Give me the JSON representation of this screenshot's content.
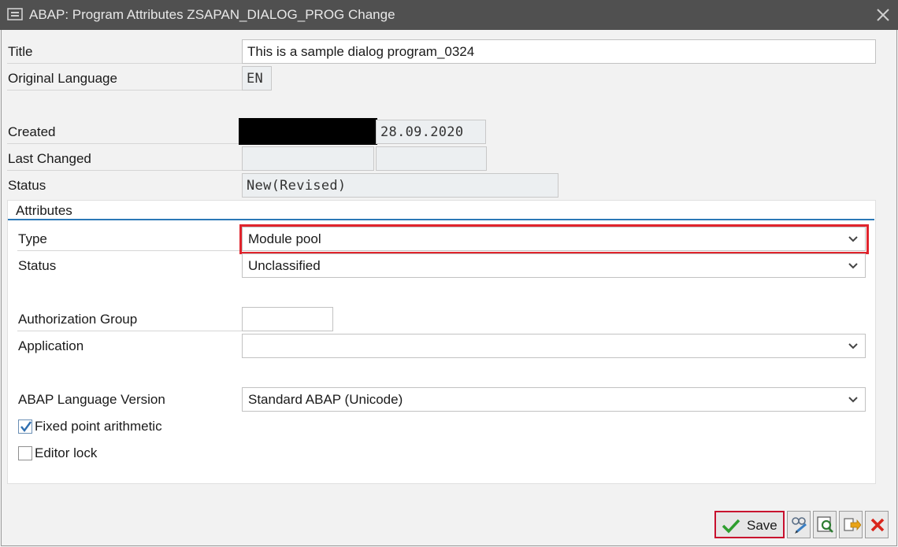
{
  "window": {
    "title": "ABAP: Program Attributes ZSAPAN_DIALOG_PROG Change"
  },
  "header_fields": {
    "title_label": "Title",
    "title_value": "This is a sample dialog program_0324",
    "original_language_label": "Original Language",
    "original_language_value": "EN",
    "created_label": "Created",
    "created_date": "28.09.2020",
    "last_changed_label": "Last Changed",
    "status_label": "Status",
    "status_value": "New(Revised)"
  },
  "attributes": {
    "section_title": "Attributes",
    "type_label": "Type",
    "type_value": "Module pool",
    "status_label": "Status",
    "status_value": "Unclassified",
    "auth_group_label": "Authorization Group",
    "auth_group_value": "",
    "application_label": "Application",
    "application_value": "",
    "abap_version_label": "ABAP Language Version",
    "abap_version_value": "Standard ABAP (Unicode)",
    "fixed_point_label": "Fixed point arithmetic",
    "fixed_point_checked": true,
    "editor_lock_label": "Editor lock",
    "editor_lock_checked": false
  },
  "toolbar": {
    "save_label": "Save"
  },
  "colors": {
    "titlebar": "#505050",
    "section_rule": "#2b78b7",
    "highlight": "#e0242c",
    "save_border": "#c8102e",
    "check_green": "#2e9e2e",
    "cancel_red": "#d9261c"
  },
  "icons": [
    "window-menu-icon",
    "close-icon",
    "chevron-down-icon",
    "check-icon",
    "save-check-icon",
    "display-change-icon",
    "search-icon",
    "transport-icon",
    "cancel-icon"
  ]
}
